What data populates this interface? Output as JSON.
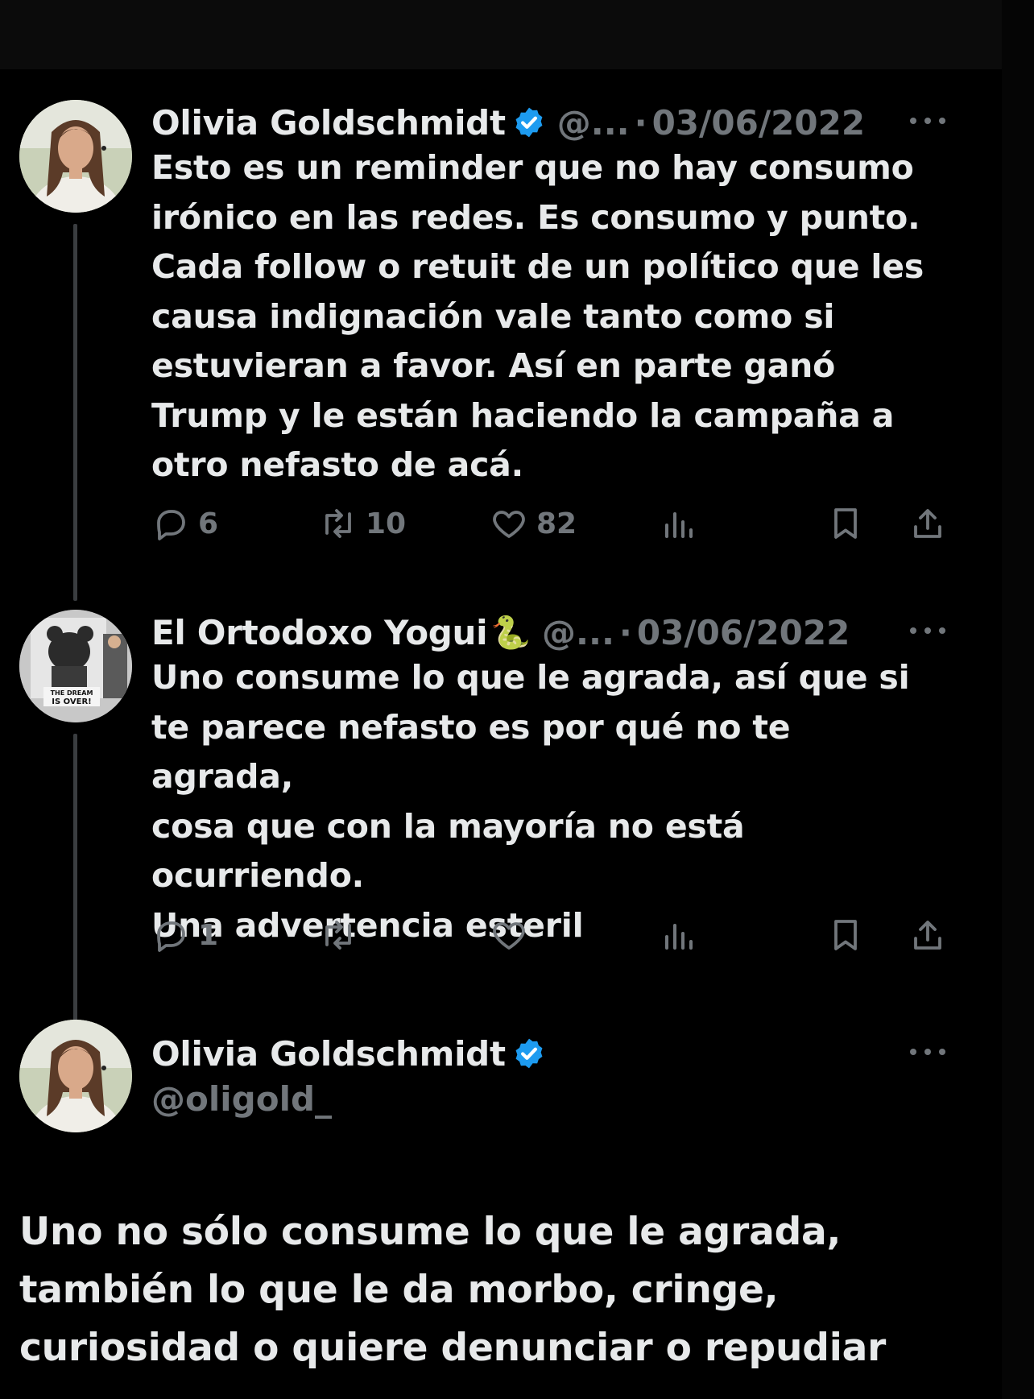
{
  "colors": {
    "background": "#000000",
    "text_primary": "#e7e9ea",
    "text_secondary": "#71767b",
    "verified_badge": "#1d9bf0",
    "thread_line": "#3a3d40"
  },
  "tweets": [
    {
      "author": "Olivia Goldschmidt",
      "verified": true,
      "handle_truncated": "@...",
      "separator": "·",
      "date": "03/06/2022",
      "text": "Esto es un reminder que no hay consumo\nirónico en las redes. Es consumo y punto.\nCada follow o retuit de un político que les\ncausa indignación vale tanto como si\nestuvieran a favor. Así en parte ganó\nTrump y le están haciendo la campaña a\notro nefasto de acá.",
      "replies": "6",
      "retweets": "10",
      "likes": "82",
      "avatar_icon": "woman-portrait-avatar"
    },
    {
      "author": "El Ortodoxo Yogui",
      "emoji": "🐍",
      "verified": false,
      "handle_truncated": "@...",
      "separator": "·",
      "date": "03/06/2022",
      "text": "Uno consume lo que le agrada, así que si\nte parece nefasto es por qué no te agrada,\ncosa que con la mayoría no está\nocurriendo.\nUna advertencia esteril",
      "replies": "1",
      "retweets": "",
      "likes": "",
      "avatar_icon": "dream-is-over-avatar",
      "avatar_caption_1": "THE DREAM",
      "avatar_caption_2": "IS OVER!"
    }
  ],
  "main_tweet": {
    "author": "Olivia Goldschmidt",
    "verified": true,
    "handle": "@oligold_",
    "text": "Uno no sólo consume lo que le agrada,\ntambién lo que le da morbo, cringe,\ncuriosidad o quiere denunciar o repudiar",
    "avatar_icon": "woman-portrait-avatar"
  },
  "icons": {
    "reply": "reply-icon",
    "retweet": "retweet-icon",
    "like": "heart-icon",
    "views": "views-icon",
    "bookmark": "bookmark-icon",
    "share": "share-icon",
    "more": "more-icon",
    "verified": "verified-badge-icon"
  }
}
